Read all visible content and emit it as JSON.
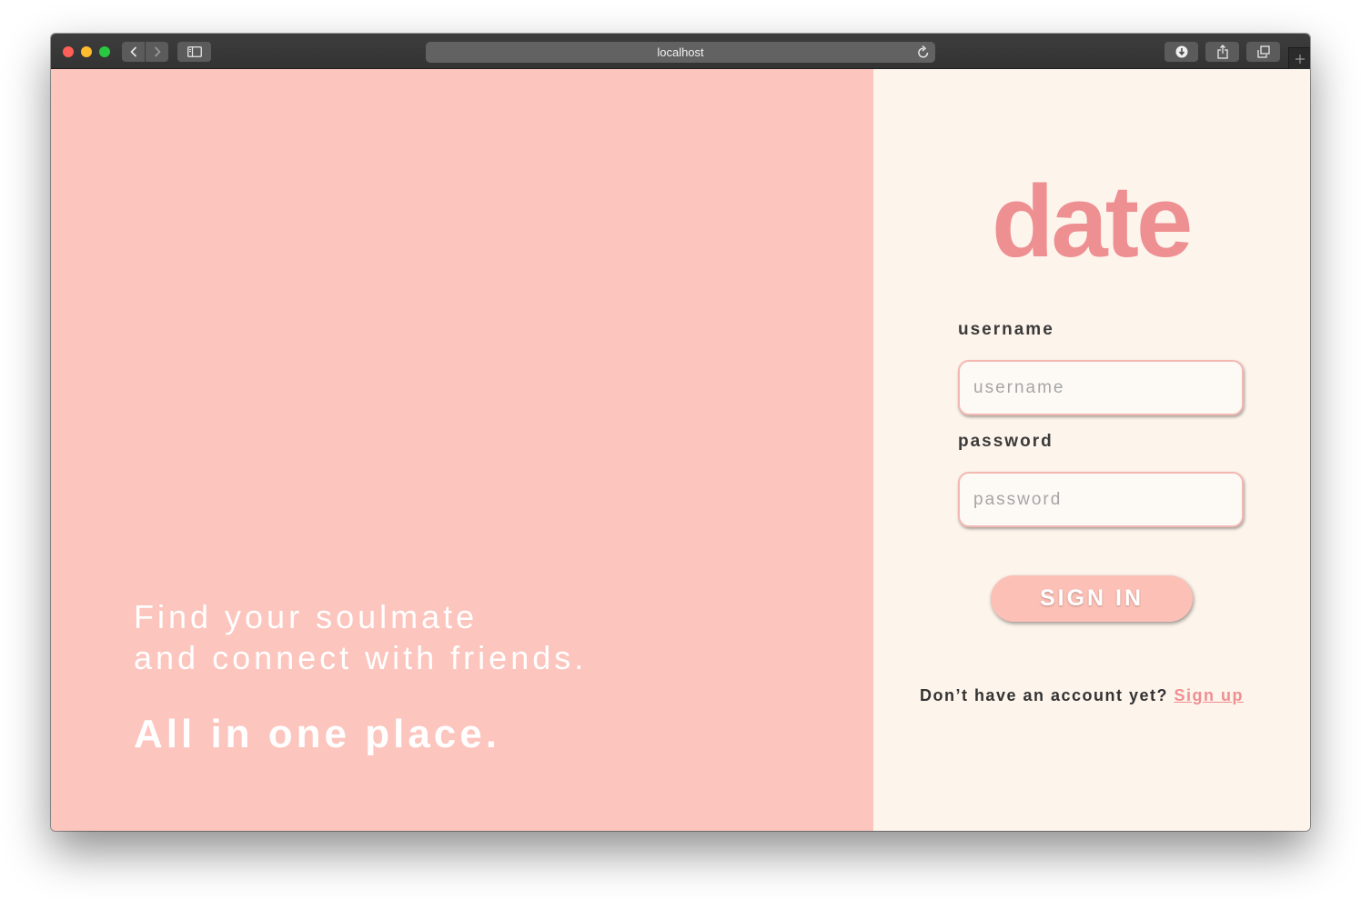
{
  "browser": {
    "url": "localhost",
    "controls": {
      "back_icon": "chevron-left-icon",
      "forward_icon": "chevron-right-icon",
      "sidebar_icon": "sidebar-icon",
      "reload_icon": "reload-icon",
      "download_icon": "download-icon",
      "share_icon": "share-icon",
      "tabs_icon": "tabs-overview-icon",
      "new_tab_icon": "plus-icon"
    }
  },
  "hero": {
    "tagline_line1": "Find your soulmate",
    "tagline_line2": "and connect with friends.",
    "tagline_strong": "All in one place."
  },
  "login": {
    "logo": "date",
    "username_label": "username",
    "username_placeholder": "username",
    "username_value": "",
    "password_label": "password",
    "password_placeholder": "password",
    "password_value": "",
    "signin_label": "SIGN IN",
    "signup_prompt": "Don’t have an account yet?",
    "signup_link": "Sign up"
  },
  "colors": {
    "left_panel_bg": "#fcc5bd",
    "right_panel_bg": "#fdf4eb",
    "accent": "#ee8f92",
    "button_bg": "#fcc0b6",
    "field_border": "#f4b8b3"
  }
}
